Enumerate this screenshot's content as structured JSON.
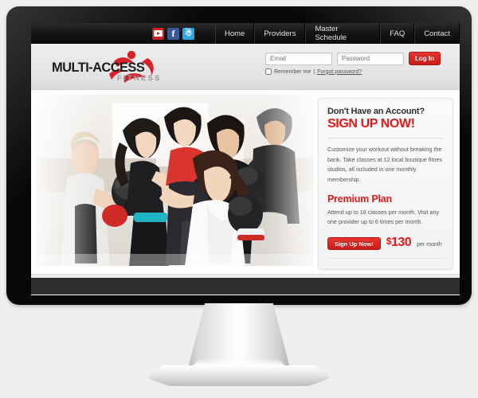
{
  "topbar": {
    "social": [
      {
        "name": "youtube-icon",
        "label": "",
        "color": "#cf2020"
      },
      {
        "name": "facebook-icon",
        "label": "f",
        "color": "#3b5998"
      },
      {
        "name": "twitter-icon",
        "label": "ᵗ",
        "color": "#2ca8e0"
      }
    ],
    "nav": [
      {
        "label": "Home"
      },
      {
        "label": "Providers"
      },
      {
        "label": "Master Schedule"
      },
      {
        "label": "FAQ"
      },
      {
        "label": "Contact"
      }
    ]
  },
  "header": {
    "logo": {
      "name": "MULTI-ACCESS",
      "tagline": "FITNESS",
      "mark_color": "#d7222a"
    },
    "login": {
      "email_placeholder": "Email",
      "email_value": "",
      "password_placeholder": "Password",
      "password_value": "",
      "submit_label": "Log In",
      "remember_label": "Remember me",
      "separator": "|",
      "forgot_label": "Forgot password?"
    }
  },
  "hero": {
    "photo_alt": "Group boxing fitness class with gloves and pads"
  },
  "signup": {
    "eyebrow": "Don't Have an Account?",
    "headline": "SIGN UP NOW!",
    "body": "Customize your workout without breaking the bank. Take classes at 12 local boutique fitnes studios, all included in one monthly membership.",
    "plan_title": "Premium Plan",
    "plan_body": "Attend up to 18 classes per month. Visit any one provider up to 6 times per month.",
    "cta_label": "Sign Up Now!",
    "price_currency": "$",
    "price_amount": "130",
    "price_period": "per month"
  },
  "theme": {
    "brand_red": "#e01b1b",
    "topbar_dark": "#0b0b0b",
    "header_gray": "#e6e6e6",
    "card_gray": "#f5f5f5"
  }
}
